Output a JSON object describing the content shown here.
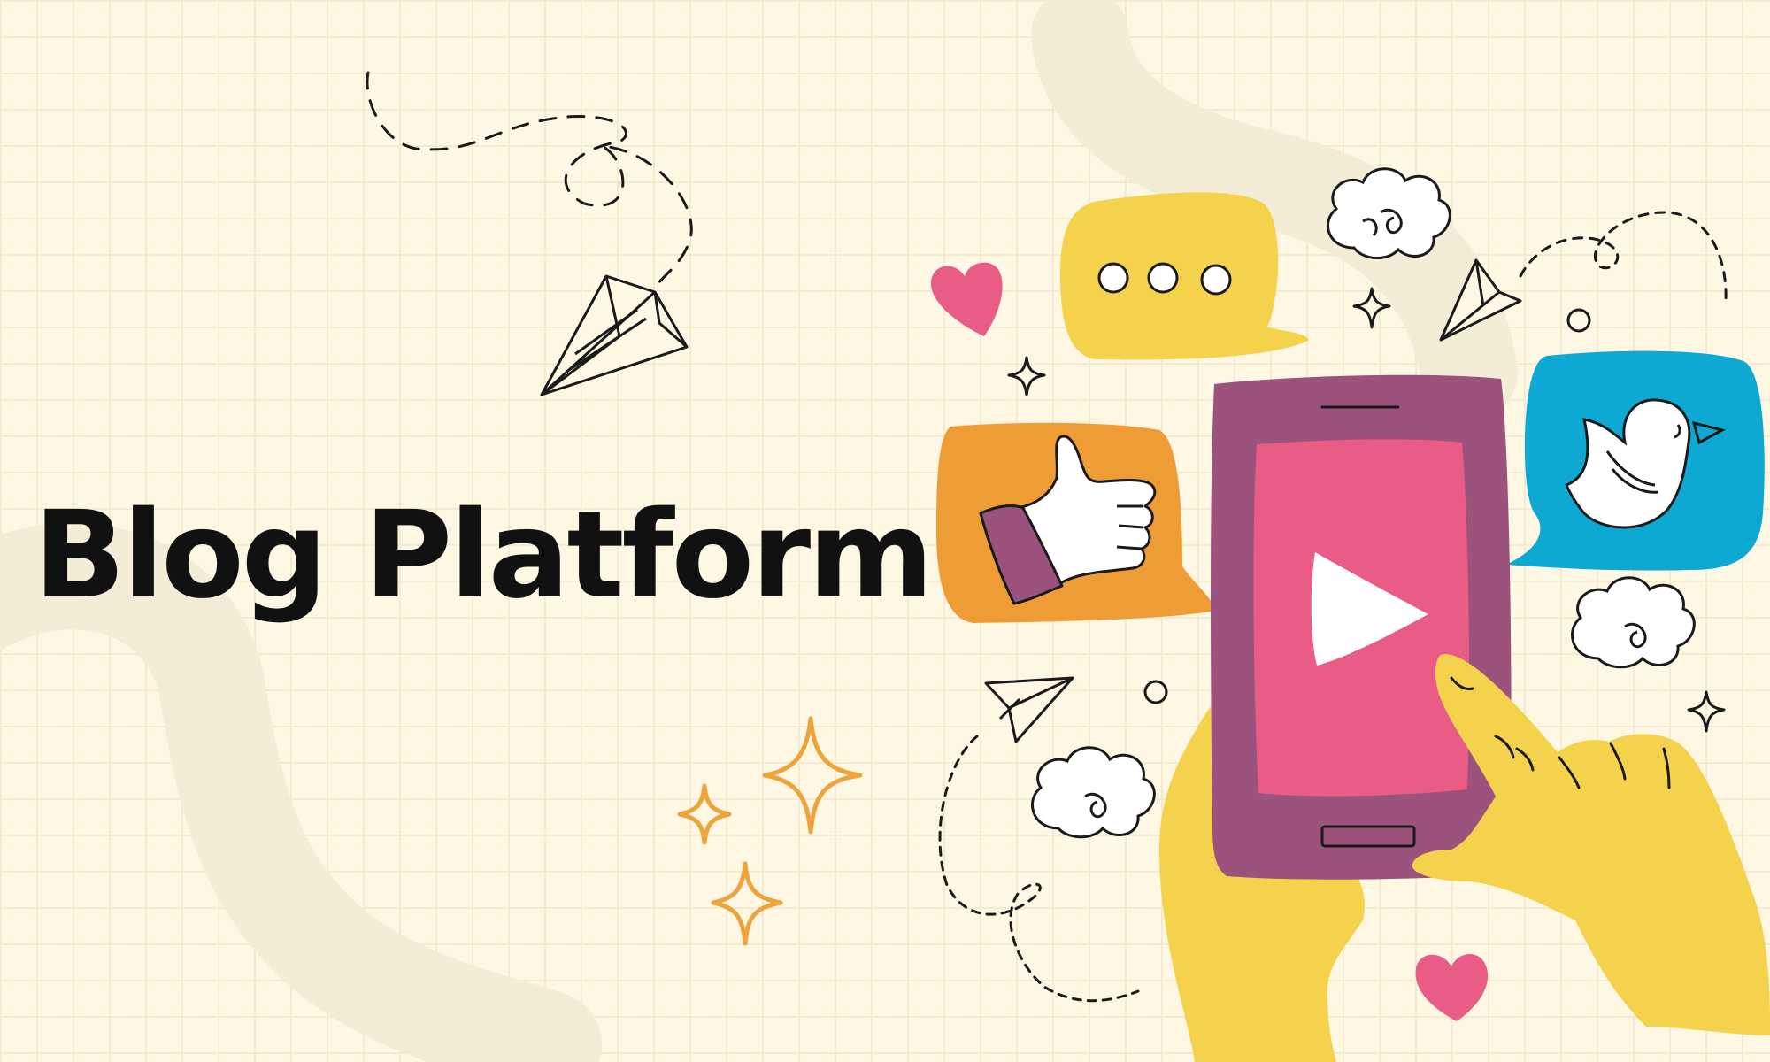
{
  "title": "Blog Platform",
  "colors": {
    "background": "#fdf7e3",
    "grid_line": "#f3ead0",
    "swoosh": "#f3ecd6",
    "text": "#111111",
    "yellow": "#f4d24c",
    "orange": "#ee9c35",
    "blue": "#0ea9d2",
    "pink": "#e85c86",
    "purple": "#9b527d",
    "star_orange": "#eea43c",
    "line": "#1a1a1a",
    "white": "#ffffff"
  },
  "icons": [
    "paper-plane-icon",
    "chat-bubble-icon",
    "thumbs-up-icon",
    "bird-icon",
    "play-icon",
    "heart-icon",
    "sparkle-icon",
    "cloud-icon",
    "smartphone-icon",
    "hand-icon"
  ]
}
